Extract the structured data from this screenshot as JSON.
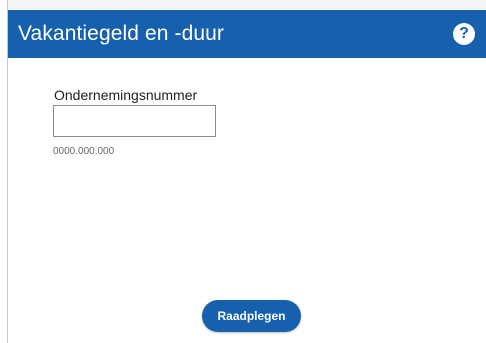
{
  "header": {
    "title": "Vakantiegeld en -duur",
    "help_icon_glyph": "?",
    "help_icon": "question-circle-icon"
  },
  "form": {
    "label": "Ondernemingsnummer",
    "value": "",
    "hint": "0000.000.000"
  },
  "actions": {
    "submit_label": "Raadplegen"
  },
  "colors": {
    "brand": "#1660ad",
    "background": "#ffffff"
  }
}
